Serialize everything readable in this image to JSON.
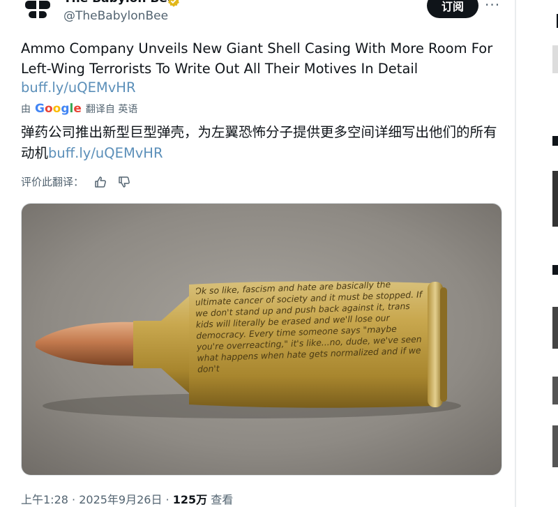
{
  "author": {
    "name": "The Babylon Bee",
    "handle": "@TheBabylonBee"
  },
  "subscribe_label": "订阅",
  "more_label": "···",
  "tweet": {
    "text_en_1": "Ammo Company Unveils New Giant Shell Casing With More Room For Left-Wing Terrorists To Write Out All Their Motives In Detail",
    "link": "buff.ly/uQEMvHR",
    "translated_by": "由",
    "google": "Google",
    "translated_from": "翻译自 英语",
    "text_zh": "弹药公司推出新型巨型弹壳，为左翼恐怖分子提供更多空间详细写出他们的所有动机",
    "link_zh": "buff.ly/uQEMvHR"
  },
  "rate_translation": "评价此翻译：",
  "casing_text": "Ok so like, fascism and hate are basically the ultimate cancer of society and it must be stopped. If we don't stand up and push back against it, trans kids will literally be erased and we'll lose our democracy. Every time someone says \"maybe you're overreacting,\" it's like...no, dude, we've seen what happens when hate gets normalized and if we don't",
  "meta": {
    "time": "上午1:28",
    "date": "2025年9月26日",
    "views": "125万",
    "views_label": "查看"
  },
  "colors": {
    "accent": "#0f1419",
    "link": "#5b8fb9",
    "muted": "#536471",
    "verified_gold": "#e2b719"
  }
}
